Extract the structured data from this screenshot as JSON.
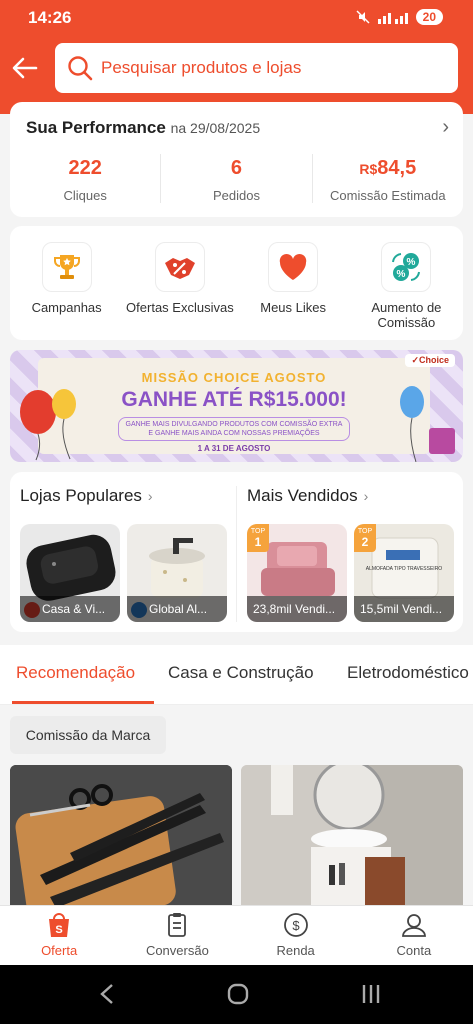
{
  "status": {
    "time": "14:26",
    "battery": "20"
  },
  "search": {
    "placeholder": "Pesquisar produtos e lojas"
  },
  "performance": {
    "title": "Sua Performance",
    "date": "na 29/08/2025",
    "stats": [
      {
        "value": "222",
        "label": "Cliques"
      },
      {
        "value": "6",
        "label": "Pedidos"
      },
      {
        "prefix": "R$",
        "value": "84,5",
        "label": "Comissão Estimada"
      }
    ]
  },
  "quick_actions": [
    {
      "label": "Campanhas",
      "icon": "trophy-icon"
    },
    {
      "label": "Ofertas Exclusivas",
      "icon": "handshake-percent-icon"
    },
    {
      "label": "Meus Likes",
      "icon": "heart-icon"
    },
    {
      "label": "Aumento de Comissão",
      "icon": "percent-exchange-icon"
    }
  ],
  "banner": {
    "line1": "MISSÃO CHOICE AGOSTO",
    "line2": "GANHE ATÉ R$15.000!",
    "line3": "GANHE MAIS DIVULGANDO PRODUTOS COM COMISSÃO EXTRA E GANHE MAIS AINDA COM NOSSAS PREMIAÇÕES",
    "line4": "1 A 31 DE AGOSTO",
    "brand": "Choice"
  },
  "popular": {
    "stores_title": "Lojas Populares",
    "best_title": "Mais Vendidos",
    "stores": [
      {
        "name": "Casa & Vi..."
      },
      {
        "name": "Global Al..."
      }
    ],
    "best": [
      {
        "rank_label": "TOP",
        "rank": "1",
        "sold": "23,8mil Vendi..."
      },
      {
        "rank_label": "TOP",
        "rank": "2",
        "sold": "15,5mil Vendi..."
      }
    ],
    "pillow_text": "ALMOFADA TIPO TRAVESSEIRO"
  },
  "tabs": [
    "Recomendação",
    "Casa e Construção",
    "Eletrodoméstico"
  ],
  "filter_chip": "Comissão da Marca",
  "bottom_nav": [
    {
      "label": "Oferta",
      "icon": "shopping-bag-icon",
      "active": true
    },
    {
      "label": "Conversão",
      "icon": "clipboard-icon",
      "active": false
    },
    {
      "label": "Renda",
      "icon": "dollar-circle-icon",
      "active": false
    },
    {
      "label": "Conta",
      "icon": "user-icon",
      "active": false
    }
  ],
  "colors": {
    "accent": "#ee4d2d",
    "banner_purple": "#8a52c6",
    "badge_orange": "#f5a33c"
  }
}
